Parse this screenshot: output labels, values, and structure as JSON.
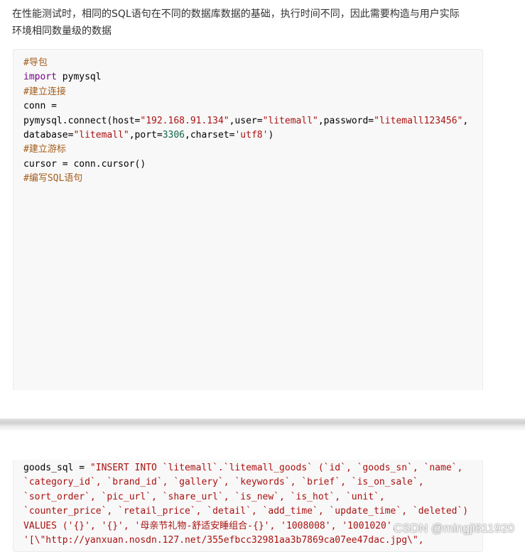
{
  "intro": {
    "line1": "在性能测试时，相同的SQL语句在不同的数据库数据的基础，执行时间不同，因此需要构造与用户实际",
    "line2": "环境相同数量级的数据"
  },
  "code_block_1": {
    "comment_import": "#导包",
    "kw_import": "import",
    "module": " pymysql",
    "comment_connect": "#建立连接",
    "conn_assign": "conn =",
    "connect_call": "pymysql.connect(host=",
    "host_val": "\"192.168.91.134\"",
    "user_key": ",user=",
    "user_val": "\"litemall\"",
    "password_key": ",password=",
    "password_val": "\"litemall123456\"",
    "comma": ",",
    "database_key": "database=",
    "database_val": "\"litemall\"",
    "port_key": ",port=",
    "port_val": "3306",
    "charset_key": ",charset=",
    "charset_val": "'utf8'",
    "close_paren": ")",
    "comment_cursor": "#建立游标",
    "cursor_line": "cursor = conn.cursor()",
    "comment_sql": "#编写SQL语句"
  },
  "code_block_2": {
    "var": "goods_sql = ",
    "line1": "\"INSERT INTO `litemall`.`litemall_goods` (`id`, `goods_sn`, `name`,",
    "line2": "`category_id`, `brand_id`, `gallery`, `keywords`, `brief`, `is_on_sale`,",
    "line3": "`sort_order`, `pic_url`, `share_url`, `is_new`, `is_hot`, `unit`,",
    "line4": "`counter_price`, `retail_price`, `detail`, `add_time`, `update_time`, `deleted`)",
    "line5": "VALUES ('{}', '{}', '母亲节礼物-舒适安睡组合-{}', '1008008', '1001020',",
    "line6": "'[\\\"http://yanxuan.nosdn.127.net/355efbcc32981aa3b7869ca07ee47dac.jpg\\\","
  },
  "watermark": "CSDN @mingji811920"
}
